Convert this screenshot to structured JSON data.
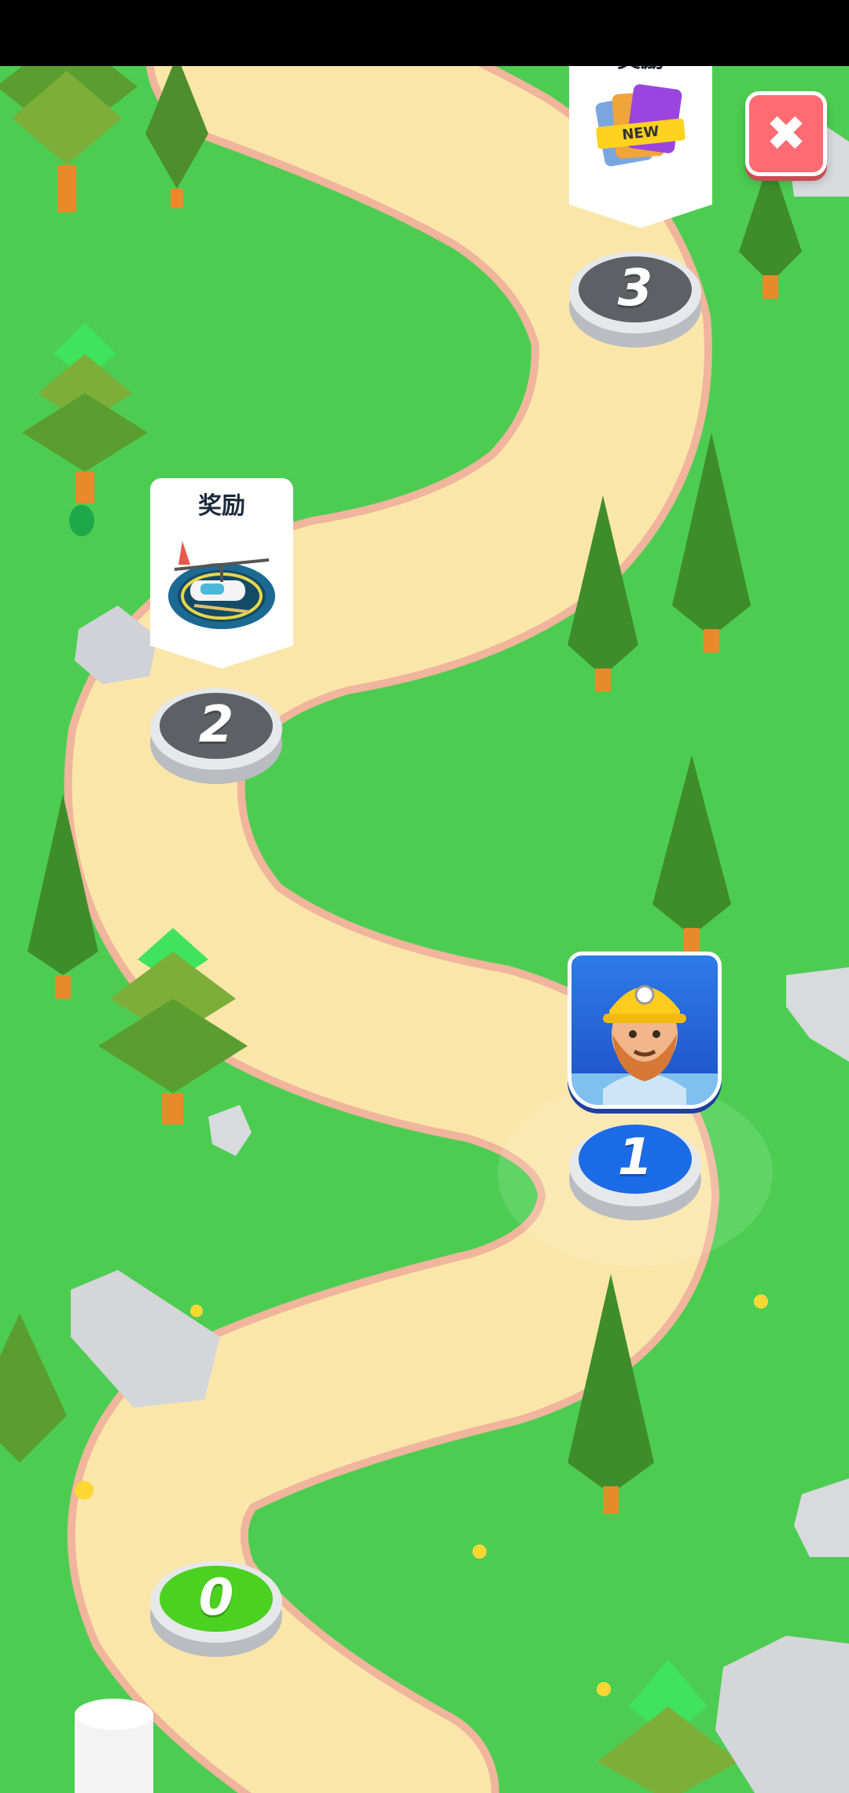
{
  "screen": "level-map",
  "close_button": {
    "icon": "close-x-icon",
    "glyph": "✖"
  },
  "reward_label": "奖励",
  "rewards": [
    {
      "level": "3",
      "label": "奖励",
      "badge": "NEW",
      "icon": "card-pack-icon"
    },
    {
      "level": "2",
      "label": "奖励",
      "icon": "helicopter-pad-icon"
    }
  ],
  "player_avatar": {
    "icon": "bearded-miner-avatar",
    "current_level": "1"
  },
  "levels": [
    {
      "num": "3",
      "state": "locked",
      "color": "#5e6066"
    },
    {
      "num": "2",
      "state": "locked",
      "color": "#5e6066"
    },
    {
      "num": "1",
      "state": "current",
      "color": "#1c6be6"
    },
    {
      "num": "0",
      "state": "completed",
      "color": "#4bd11f"
    }
  ],
  "colors": {
    "grass": "#4ccd52",
    "path": "#fbe6aa",
    "path_edge": "#f2b59a",
    "tree_dark": "#3e8f2c",
    "trunk": "#e8892a"
  }
}
